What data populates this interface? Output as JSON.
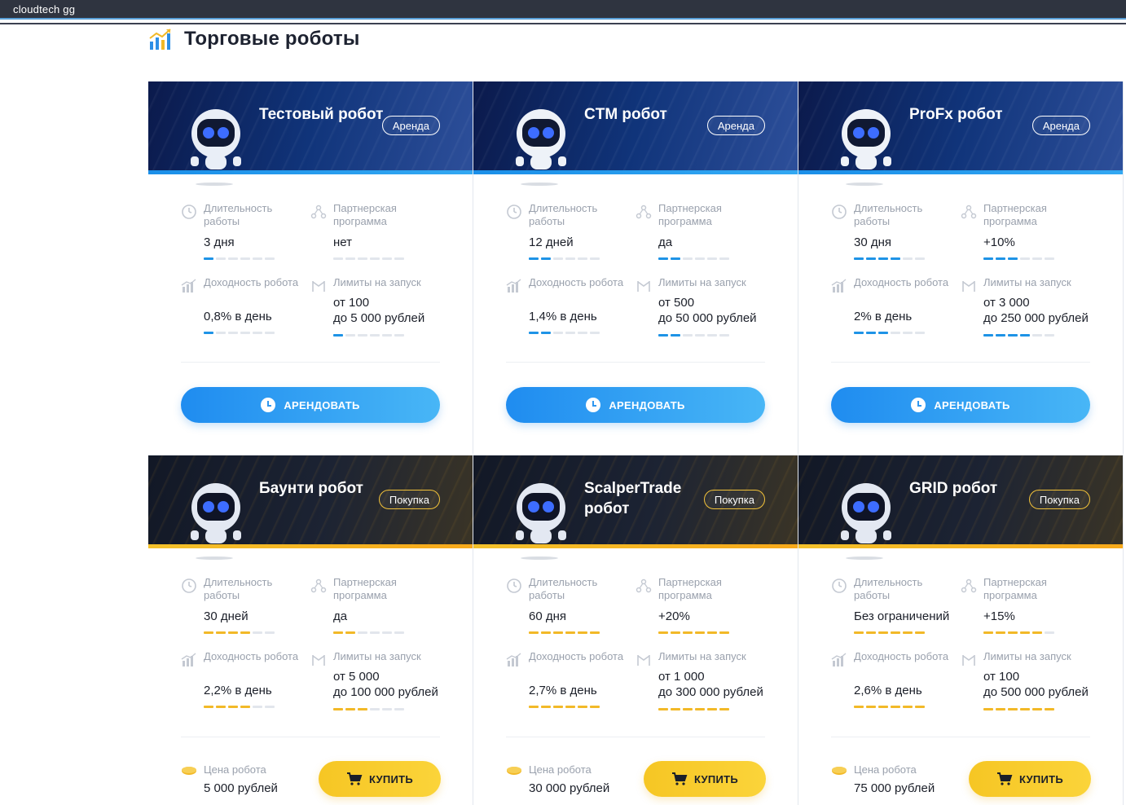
{
  "window": {
    "title": "cloudtech gg"
  },
  "page": {
    "title": "Торговые роботы"
  },
  "labels": {
    "duration": "Длительность работы",
    "partner": "Партнерская программа",
    "yield": "Доходность робота",
    "limits": "Лимиты на запуск",
    "price": "Цена робота",
    "rent_button": "АРЕНДОВАТЬ",
    "buy_button": "КУПИТЬ"
  },
  "colors": {
    "rent_accent": "#1e93e6",
    "buy_accent": "#f2b928",
    "rent_banner": "#10347a",
    "buy_banner": "#1c2333"
  },
  "robots": [
    {
      "name": "Тестовый робот",
      "badge": "Аренда",
      "mode": "rent",
      "duration": "3 дня",
      "duration_level": 1,
      "partner": "нет",
      "partner_level": 0,
      "yield": "0,8% в день",
      "yield_level": 1,
      "limits_from": "от 100",
      "limits_to": "до 5 000 рублей",
      "limits_level": 1
    },
    {
      "name": "CTM робот",
      "badge": "Аренда",
      "mode": "rent",
      "duration": "12 дней",
      "duration_level": 2,
      "partner": "да",
      "partner_level": 2,
      "yield": "1,4% в день",
      "yield_level": 2,
      "limits_from": "от 500",
      "limits_to": "до 50 000 рублей",
      "limits_level": 2
    },
    {
      "name": "ProFx робот",
      "badge": "Аренда",
      "mode": "rent",
      "duration": "30 дня",
      "duration_level": 4,
      "partner": "+10%",
      "partner_level": 3,
      "yield": "2% в день",
      "yield_level": 3,
      "limits_from": "от 3 000",
      "limits_to": "до 250 000 рублей",
      "limits_level": 4
    },
    {
      "name": "Баунти робот",
      "badge": "Покупка",
      "mode": "buy",
      "duration": "30 дней",
      "duration_level": 4,
      "partner": "да",
      "partner_level": 2,
      "yield": "2,2% в день",
      "yield_level": 4,
      "limits_from": "от 5 000",
      "limits_to": "до 100 000 рублей",
      "limits_level": 3,
      "price": "5 000 рублей"
    },
    {
      "name": "ScalperTrade робот",
      "badge": "Покупка",
      "mode": "buy",
      "duration": "60 дня",
      "duration_level": 6,
      "partner": "+20%",
      "partner_level": 6,
      "yield": "2,7% в день",
      "yield_level": 6,
      "limits_from": "от 1 000",
      "limits_to": "до 300 000 рублей",
      "limits_level": 6,
      "price": "30 000 рублей"
    },
    {
      "name": "GRID робот",
      "badge": "Покупка",
      "mode": "buy",
      "duration": "Без ограничений",
      "duration_level": 6,
      "partner": "+15%",
      "partner_level": 5,
      "yield": "2,6% в день",
      "yield_level": 6,
      "limits_from": "от 100",
      "limits_to": "до 500 000 рублей",
      "limits_level": 6,
      "price": "75 000 рублей"
    }
  ]
}
